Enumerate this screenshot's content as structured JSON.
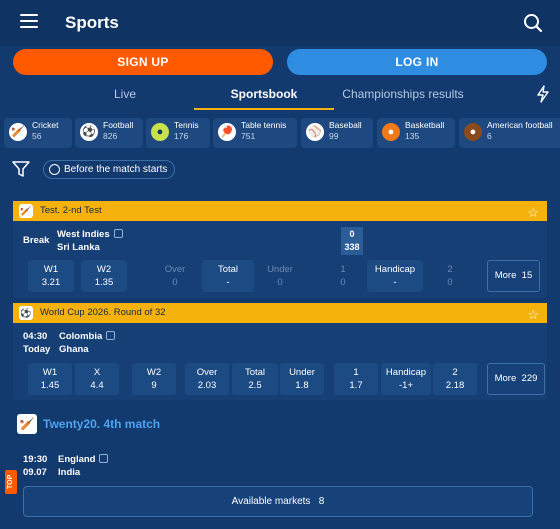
{
  "header": {
    "title": "Sports"
  },
  "auth": {
    "signup_label": "SIGN UP",
    "login_label": "LOG IN"
  },
  "tabs": [
    {
      "label": "Live",
      "active": false
    },
    {
      "label": "Sportsbook",
      "active": true
    },
    {
      "label": "Championships results",
      "active": false
    }
  ],
  "sports": [
    {
      "name": "Cricket",
      "count": "56",
      "icon": "cricket-icon"
    },
    {
      "name": "Football",
      "count": "826",
      "icon": "football-icon"
    },
    {
      "name": "Tennis",
      "count": "176",
      "icon": "tennis-icon"
    },
    {
      "name": "Table tennis",
      "count": "751",
      "icon": "table-tennis-icon"
    },
    {
      "name": "Baseball",
      "count": "99",
      "icon": "baseball-icon"
    },
    {
      "name": "Basketball",
      "count": "135",
      "icon": "basketball-icon"
    },
    {
      "name": "American football",
      "count": "6",
      "icon": "american-football-icon"
    }
  ],
  "filter": {
    "before_label": "Before the match starts"
  },
  "matches": [
    {
      "league": "Test. 2-nd Test",
      "status": "Break",
      "team1": "West Indies",
      "team2": "Sri Lanka",
      "score1": "0",
      "score2": "338",
      "odds": [
        {
          "label": "W1",
          "value": "3.21"
        },
        {
          "label": "W2",
          "value": "1.35"
        },
        {
          "label": "Over",
          "value": "0"
        },
        {
          "label": "Total",
          "value": "-"
        },
        {
          "label": "Under",
          "value": "0"
        },
        {
          "label": "1",
          "value": "0"
        },
        {
          "label": "Handicap",
          "value": "-"
        },
        {
          "label": "2",
          "value": "0"
        }
      ],
      "more_label": "More",
      "more_count": "15"
    },
    {
      "league": "World Cup 2026. Round of 32",
      "time": "04:30",
      "day": "Today",
      "team1": "Colombia",
      "team2": "Ghana",
      "odds": [
        {
          "label": "W1",
          "value": "1.45"
        },
        {
          "label": "X",
          "value": "4.4"
        },
        {
          "label": "W2",
          "value": "9"
        },
        {
          "label": "Over",
          "value": "2.03"
        },
        {
          "label": "Total",
          "value": "2.5"
        },
        {
          "label": "Under",
          "value": "1.8"
        },
        {
          "label": "1",
          "value": "1.7"
        },
        {
          "label": "Handicap",
          "value": "-1+"
        },
        {
          "label": "2",
          "value": "2.18"
        }
      ],
      "more_label": "More",
      "more_count": "229"
    }
  ],
  "featured": {
    "league": "Twenty20. 4th match",
    "time": "19:30",
    "date": "09.07",
    "team1": "England",
    "team2": "India",
    "badge": "TOP",
    "markets_label": "Available markets",
    "markets_count": "8"
  },
  "colors": {
    "accent_orange": "#ff5a00",
    "accent_blue": "#2e8de0",
    "league_yellow": "#f5b10c",
    "background": "#123a6f"
  }
}
